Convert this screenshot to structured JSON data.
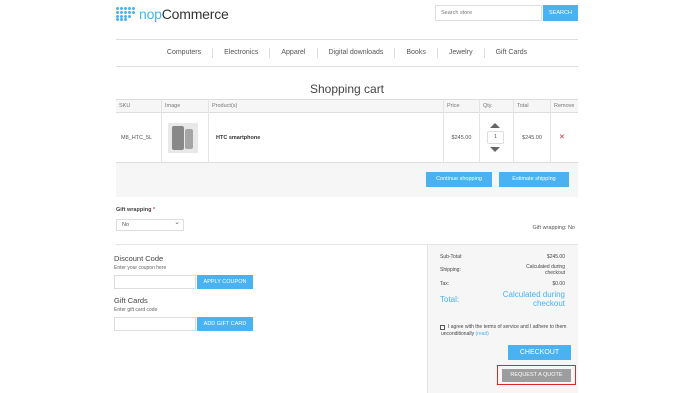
{
  "header": {
    "logo_prefix": "nop",
    "logo_suffix": "Commerce",
    "search_placeholder": "Search store",
    "search_button": "SEARCH"
  },
  "menu": [
    "Computers",
    "Electronics",
    "Apparel",
    "Digital downloads",
    "Books",
    "Jewelry",
    "Gift Cards"
  ],
  "page_title": "Shopping cart",
  "cart": {
    "columns": [
      "SKU",
      "Image",
      "Product(s)",
      "Price",
      "Qty.",
      "Total",
      "Remove"
    ],
    "rows": [
      {
        "sku": "M8_HTC_5L",
        "product": "HTC smartphone",
        "price": "$245.00",
        "qty": "1",
        "total": "$245.00",
        "remove": "✕"
      }
    ],
    "continue_shopping": "Continue shopping",
    "estimate_shipping": "Estimate shipping"
  },
  "gift_wrapping": {
    "label": "Gift wrapping",
    "required_mark": "*",
    "selected": "No",
    "info": "Gift wrapping: No"
  },
  "discount": {
    "title": "Discount Code",
    "hint": "Enter your coupon here",
    "button": "APPLY COUPON"
  },
  "giftcards": {
    "title": "Gift Cards",
    "hint": "Enter gift card code",
    "button": "ADD GIFT CARD"
  },
  "totals": {
    "subtotal_label": "Sub-Total:",
    "subtotal_value": "$245.00",
    "shipping_label": "Shipping:",
    "shipping_value": "Calculated during checkout",
    "tax_label": "Tax:",
    "tax_value": "$0.00",
    "total_label": "Total:",
    "total_value": "Calculated during checkout"
  },
  "terms": {
    "text": "I agree with the terms of service and I adhere to them unconditionally",
    "link": "(read)"
  },
  "checkout_button": "CHECKOUT",
  "request_quote_button": "REQUEST A QUOTE",
  "colors": {
    "accent": "#4ab2f1",
    "remove": "#d9272e",
    "quote_button": "#9d9d9d",
    "highlight_outline": "#d9272e"
  }
}
